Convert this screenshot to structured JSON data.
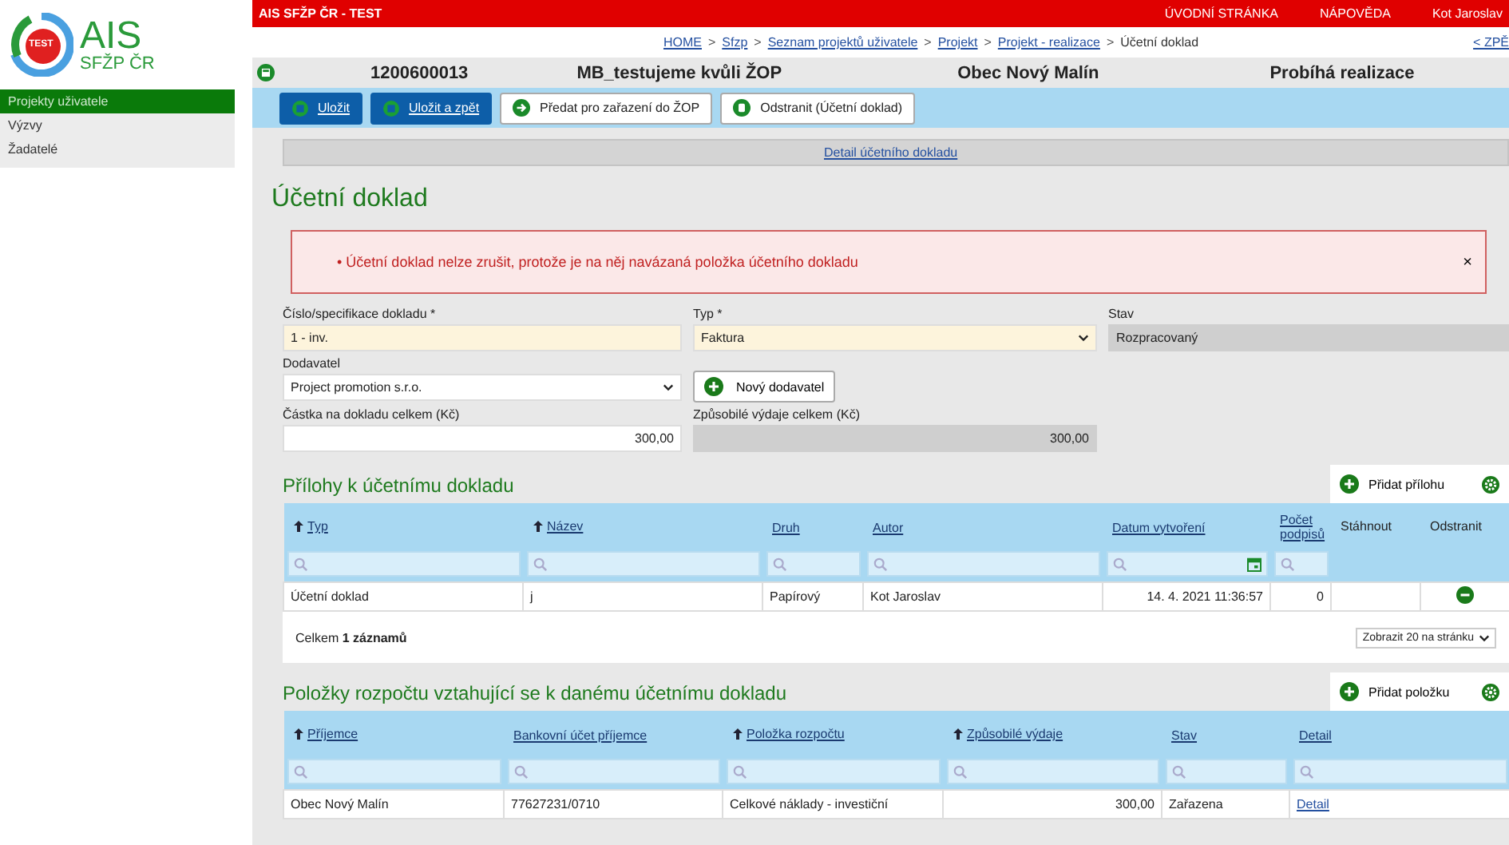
{
  "sidebar": {
    "logo": {
      "title": "AIS",
      "subtitle": "SFŽP ČR",
      "badge": "TEST"
    },
    "items": [
      {
        "label": "Projekty uživatele",
        "selected": true
      },
      {
        "label": "Výzvy",
        "selected": false
      },
      {
        "label": "Žadatelé",
        "selected": false
      }
    ]
  },
  "topbar": {
    "title": "AIS SFŽP ČR - TEST",
    "links": [
      "ÚVODNÍ STRÁNKA",
      "NÁPOVĚDA",
      "Kot Jaroslav"
    ]
  },
  "breadcrumb": {
    "items": [
      {
        "label": "HOME",
        "link": true
      },
      {
        "label": "Sfzp",
        "link": true
      },
      {
        "label": "Seznam projektů uživatele",
        "link": true
      },
      {
        "label": "Projekt",
        "link": true
      },
      {
        "label": "Projekt - realizace",
        "link": true
      },
      {
        "label": "Účetní doklad",
        "link": false
      }
    ],
    "separator": ">",
    "back": "< ZPĚ"
  },
  "project": {
    "number": "1200600013",
    "name": "MB_testujeme kvůli ŽOP",
    "applicant": "Obec Nový Malín",
    "status": "Probíhá realizace"
  },
  "toolbar": [
    {
      "label": "Uložit",
      "kind": "save"
    },
    {
      "label": "Uložit a zpět",
      "kind": "save"
    },
    {
      "label": "Předat pro zařazení do ŽOP",
      "kind": "forward"
    },
    {
      "label": "Odstranit (Účetní doklad)",
      "kind": "remove"
    }
  ],
  "subtab": "Detail účetního dokladu",
  "heading": "Účetní doklad",
  "error": {
    "bullet": "•",
    "message": "Účetní doklad nelze zrušit, protože je na něj navázaná položka účetního dokladu",
    "close": "×"
  },
  "form": {
    "number": {
      "label": "Číslo/specifikace dokladu *",
      "value": "1 - inv."
    },
    "type": {
      "label": "Typ *",
      "value": "Faktura"
    },
    "state": {
      "label": "Stav",
      "value": "Rozpracovaný"
    },
    "supplier": {
      "label": "Dodavatel",
      "value": "Project promotion s.r.o."
    },
    "new_supplier": "Nový dodavatel",
    "amount": {
      "label": "Částka na dokladu celkem (Kč)",
      "value": "300,00"
    },
    "eligible": {
      "label": "Způsobilé výdaje celkem (Kč)",
      "value": "300,00"
    }
  },
  "attachments": {
    "title": "Přílohy k účetnímu dokladu",
    "add": "Přidat přílohu",
    "columns": [
      {
        "label": "Typ",
        "sortable": true,
        "kind": "text"
      },
      {
        "label": "Název",
        "sortable": true,
        "kind": "text"
      },
      {
        "label": "Druh",
        "sortable": false,
        "kind": "text"
      },
      {
        "label": "Autor",
        "sortable": false,
        "kind": "text"
      },
      {
        "label": "Datum vytvoření",
        "sortable": false,
        "kind": "date"
      },
      {
        "label": "Počet podpisů",
        "sortable": false,
        "kind": "text"
      },
      {
        "label": "Stáhnout",
        "kind": "action"
      },
      {
        "label": "Odstranit",
        "kind": "action"
      }
    ],
    "rows": [
      {
        "cells": [
          "Účetní doklad",
          "j",
          "Papírový",
          "Kot Jaroslav",
          "14. 4. 2021 11:36:57",
          "0"
        ],
        "delete": true
      }
    ],
    "total": "Celkem **1 záznamů**",
    "page_size": "Zobrazit 20 na stránku"
  },
  "budget": {
    "title": "Položky rozpočtu vztahující se k danému účetnímu dokladu",
    "add": "Přidat položku",
    "columns": [
      {
        "label": "Příjemce",
        "sortable": true
      },
      {
        "label": "Bankovní účet příjemce",
        "sortable": false
      },
      {
        "label": "Položka rozpočtu",
        "sortable": true
      },
      {
        "label": "Způsobilé výdaje",
        "sortable": true
      },
      {
        "label": "Stav",
        "sortable": false
      },
      {
        "label": "Detail",
        "sortable": false
      }
    ],
    "rows": [
      {
        "cells": [
          "Obec Nový Malín",
          "77627231/0710",
          "Celkové náklady - investiční",
          "300,00",
          "Zařazena"
        ],
        "link": "Detail"
      }
    ]
  }
}
